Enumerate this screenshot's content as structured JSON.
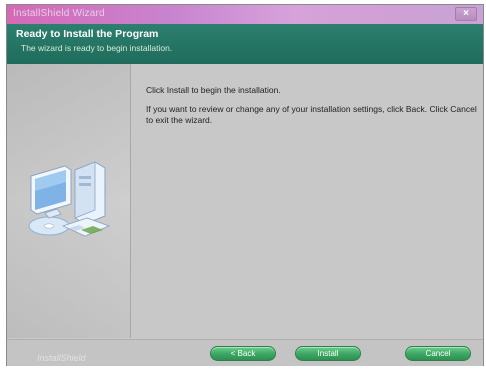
{
  "window": {
    "title": "InstallShield Wizard",
    "close_glyph": "×"
  },
  "header": {
    "title": "Ready to Install the Program",
    "subtitle": "The wizard is ready to begin installation."
  },
  "content": {
    "line1": "Click Install to begin the installation.",
    "line2": "If you want to review or change any of your installation settings, click Back. Click Cancel to exit the wizard."
  },
  "footer": {
    "brand": "InstallShield",
    "back_label": "< Back",
    "install_label": "Install",
    "cancel_label": "Cancel"
  },
  "icons": {
    "side_illustration": "computer-icon"
  },
  "colors": {
    "header_bg": "#2c7f6e",
    "button_green": "#3ea966",
    "titlebar_pink": "#d46ab6"
  }
}
